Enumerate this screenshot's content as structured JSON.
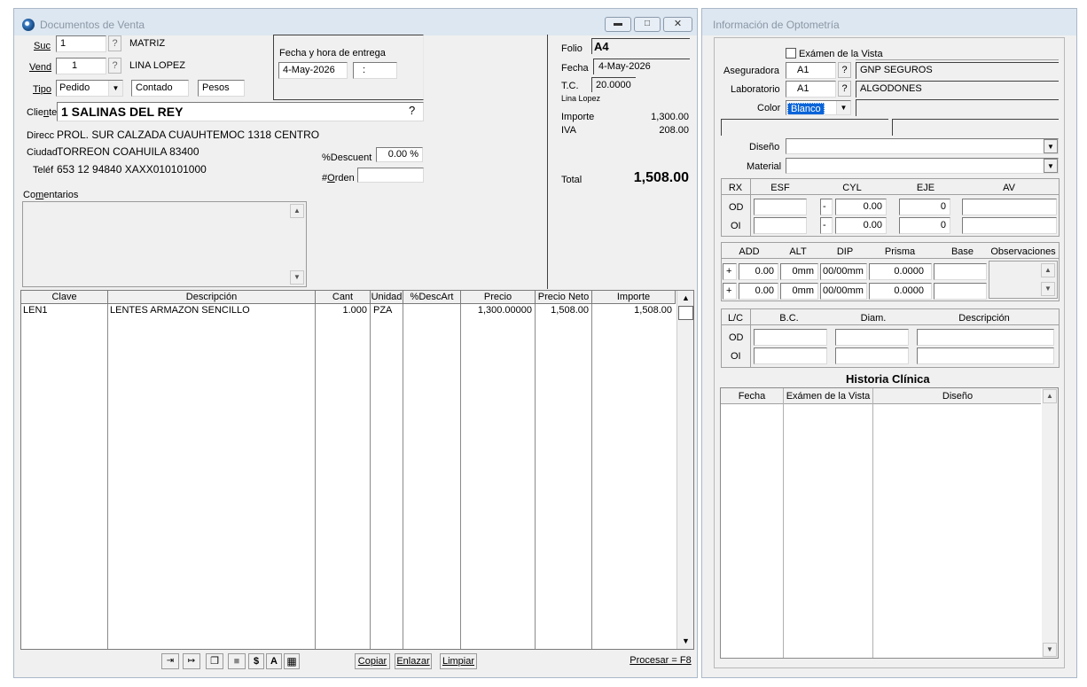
{
  "sales": {
    "title": "Documentos de Venta",
    "suc": {
      "label": "Suc",
      "value": "1",
      "name": "MATRIZ"
    },
    "vend": {
      "label": "Vend",
      "value": "1",
      "name": "LINA LOPEZ"
    },
    "tipo": {
      "label": "Tipo",
      "value": "Pedido",
      "payment": "Contado",
      "currency": "Pesos"
    },
    "delivery": {
      "label": "Fecha y hora de entrega",
      "date": "4-May-2026",
      "time": ":"
    },
    "cliente": {
      "label": "Cliente",
      "value": "1 SALINAS DEL REY"
    },
    "direcc": {
      "label": "Direcc",
      "value": "PROL. SUR CALZADA CUAUHTEMOC 1318 CENTRO"
    },
    "ciudad": {
      "label": "Ciudad",
      "value": "TORREON COAHUILA 83400"
    },
    "telef": {
      "label": "Teléf",
      "value": "653 12 94840 XAXX010101000"
    },
    "descuento": {
      "label": "%Descuent",
      "value": "0.00 %"
    },
    "orden": {
      "label": "#Orden",
      "value": ""
    },
    "comentarios_label": "Comentarios",
    "folio": {
      "label": "Folio",
      "value": "A4"
    },
    "fecha": {
      "label": "Fecha",
      "value": "4-May-2026"
    },
    "tc": {
      "label": "T.C.",
      "value": "20.0000",
      "user": "Lina Lopez"
    },
    "importe": {
      "label": "Importe",
      "value": "1,300.00"
    },
    "iva": {
      "label": "IVA",
      "value": "208.00"
    },
    "total": {
      "label": "Total",
      "value": "1,508.00"
    },
    "grid": {
      "headers": [
        "Clave",
        "Descripción",
        "Cant",
        "Unidad",
        "%DescArt",
        "Precio",
        "Precio Neto",
        "Importe"
      ],
      "rows": [
        {
          "clave": "LEN1",
          "descripcion": "LENTES ARMAZON SENCILLO",
          "cant": "1.000",
          "unidad": "PZA",
          "descart": "",
          "precio": "1,300.00000",
          "precio_neto": "1,508.00",
          "importe": "1,508.00"
        }
      ]
    },
    "toolbar": {
      "dollar": "$",
      "a": "A",
      "copiar": "Copiar",
      "enlazar": "Enlazar",
      "limpiar": "Limpiar",
      "procesar": "Procesar = F8"
    }
  },
  "opto": {
    "title": "Información de Optometría",
    "examen_label": "Exámen de la Vista",
    "aseguradora": {
      "label": "Aseguradora",
      "code": "A1",
      "name": "GNP SEGUROS"
    },
    "laboratorio": {
      "label": "Laboratorio",
      "code": "A1",
      "name": "ALGODONES"
    },
    "color": {
      "label": "Color",
      "value": "Blanco"
    },
    "diseno_label": "Diseño",
    "material_label": "Material",
    "rx": {
      "headers": [
        "RX",
        "ESF",
        "CYL",
        "EJE",
        "AV"
      ],
      "od": {
        "label": "OD",
        "sign": "-",
        "cyl": "0.00",
        "eje": "0"
      },
      "oi": {
        "label": "OI",
        "sign": "-",
        "cyl": "0.00",
        "eje": "0"
      }
    },
    "add": {
      "headers": [
        "ADD",
        "ALT",
        "DIP",
        "Prisma",
        "Base",
        "Observaciones"
      ],
      "rows": [
        {
          "sign": "+",
          "add": "0.00",
          "alt": "0mm",
          "dip": "00/00mm",
          "prisma": "0.0000"
        },
        {
          "sign": "+",
          "add": "0.00",
          "alt": "0mm",
          "dip": "00/00mm",
          "prisma": "0.0000"
        }
      ]
    },
    "lc": {
      "headers": [
        "L/C",
        "B.C.",
        "Diam.",
        "Descripción"
      ],
      "od": "OD",
      "oi": "OI"
    },
    "historia": {
      "title": "Historia Clínica",
      "headers": [
        "Fecha",
        "Exámen de la Vista",
        "Diseño"
      ]
    }
  }
}
